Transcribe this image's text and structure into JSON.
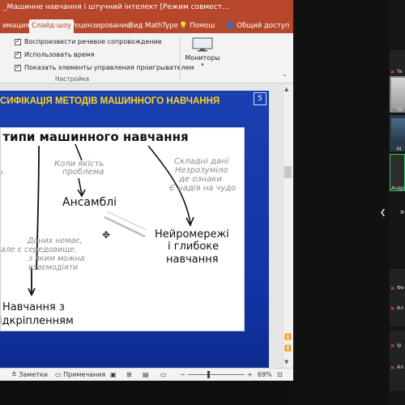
{
  "window": {
    "title": "_Машинне навчання і штучний інтелект [Режим совмест…"
  },
  "ribbon": {
    "tabs": [
      {
        "label": "имация",
        "active": false
      },
      {
        "label": "Слайд-шоу",
        "active": true
      },
      {
        "label": "Рецензирование",
        "active": false
      },
      {
        "label": "Вид",
        "active": false
      },
      {
        "label": "MathType",
        "active": false
      },
      {
        "label": "Помош",
        "active": false
      },
      {
        "label": "Общий доступ",
        "active": false
      }
    ],
    "checkboxes": [
      {
        "label": "Воспроизвести речевое сопровождение",
        "checked": true
      },
      {
        "label": "Использовать время",
        "checked": true
      },
      {
        "label": "Показать элементы управления проигрывателем",
        "checked": true
      }
    ],
    "group_label": "Настройка",
    "monitors_label": "Мониторы",
    "help_icon": "lightbulb-icon",
    "share_icon": "person-icon"
  },
  "slide": {
    "title": "СИФІКАЦІЯ МЕТОДІВ МАШИННОГО НАВЧАННЯ",
    "number": "5",
    "title_color": "#ffd71a",
    "background_color": "#1a3fb0",
    "whiteboard": {
      "header": "і типи машинного навчання",
      "note_quality": [
        "Коли якість",
        "проблема"
      ],
      "ensembles": "Ансамблі",
      "note_complex": [
        "Складні дані",
        "Незрозуміло",
        "де ознаки",
        "Є надія на чудо"
      ],
      "neural": [
        "Нейромережі",
        "і глибоке",
        "навчання"
      ],
      "note_no_data": [
        "Даних немає,",
        "але є середовище,",
        "з яким можна",
        "взаємодіяти"
      ],
      "reinforcement": [
        "Навчання з",
        "ідкріпленням"
      ]
    }
  },
  "statusbar": {
    "notes_label": "Заметки",
    "comments_label": "Примечания",
    "zoom": "69%",
    "zoom_minus": "−",
    "zoom_plus": "+"
  },
  "participants": [
    {
      "name": "Ya",
      "muted": true
    },
    {
      "name": "Ya",
      "muted": false
    },
    {
      "name": "M",
      "muted": true
    },
    {
      "name": "Андр",
      "muted": false
    },
    {
      "name": "Ф",
      "muted": false
    },
    {
      "name": "Фе",
      "muted": true
    },
    {
      "name": "Ал",
      "muted": true
    },
    {
      "name": "Ір",
      "muted": true
    },
    {
      "name": "Ал",
      "muted": true
    }
  ]
}
